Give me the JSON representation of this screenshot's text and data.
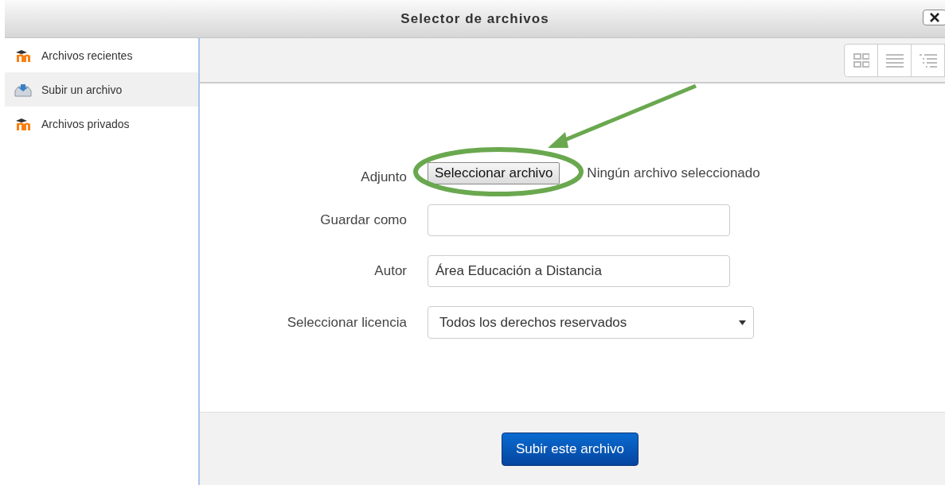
{
  "window": {
    "title": "Selector de archivos"
  },
  "sidebar": {
    "items": [
      {
        "label": "Archivos recientes",
        "kind": "moodle",
        "selected": false
      },
      {
        "label": "Subir un archivo",
        "kind": "upload",
        "selected": true
      },
      {
        "label": "Archivos privados",
        "kind": "moodle",
        "selected": false
      }
    ]
  },
  "view_buttons": [
    {
      "kind": "grid"
    },
    {
      "kind": "list"
    },
    {
      "kind": "tree"
    }
  ],
  "form": {
    "attachment": {
      "label": "Adjunto",
      "button": "Seleccionar archivo",
      "status": "Ningún archivo seleccionado"
    },
    "save_as": {
      "label": "Guardar como"
    },
    "author": {
      "label": "Autor",
      "value": "Área Educación a Distancia"
    },
    "license": {
      "label": "Seleccionar licencia",
      "value": "Todos los derechos reservados"
    }
  },
  "submit": "Subir este archivo"
}
